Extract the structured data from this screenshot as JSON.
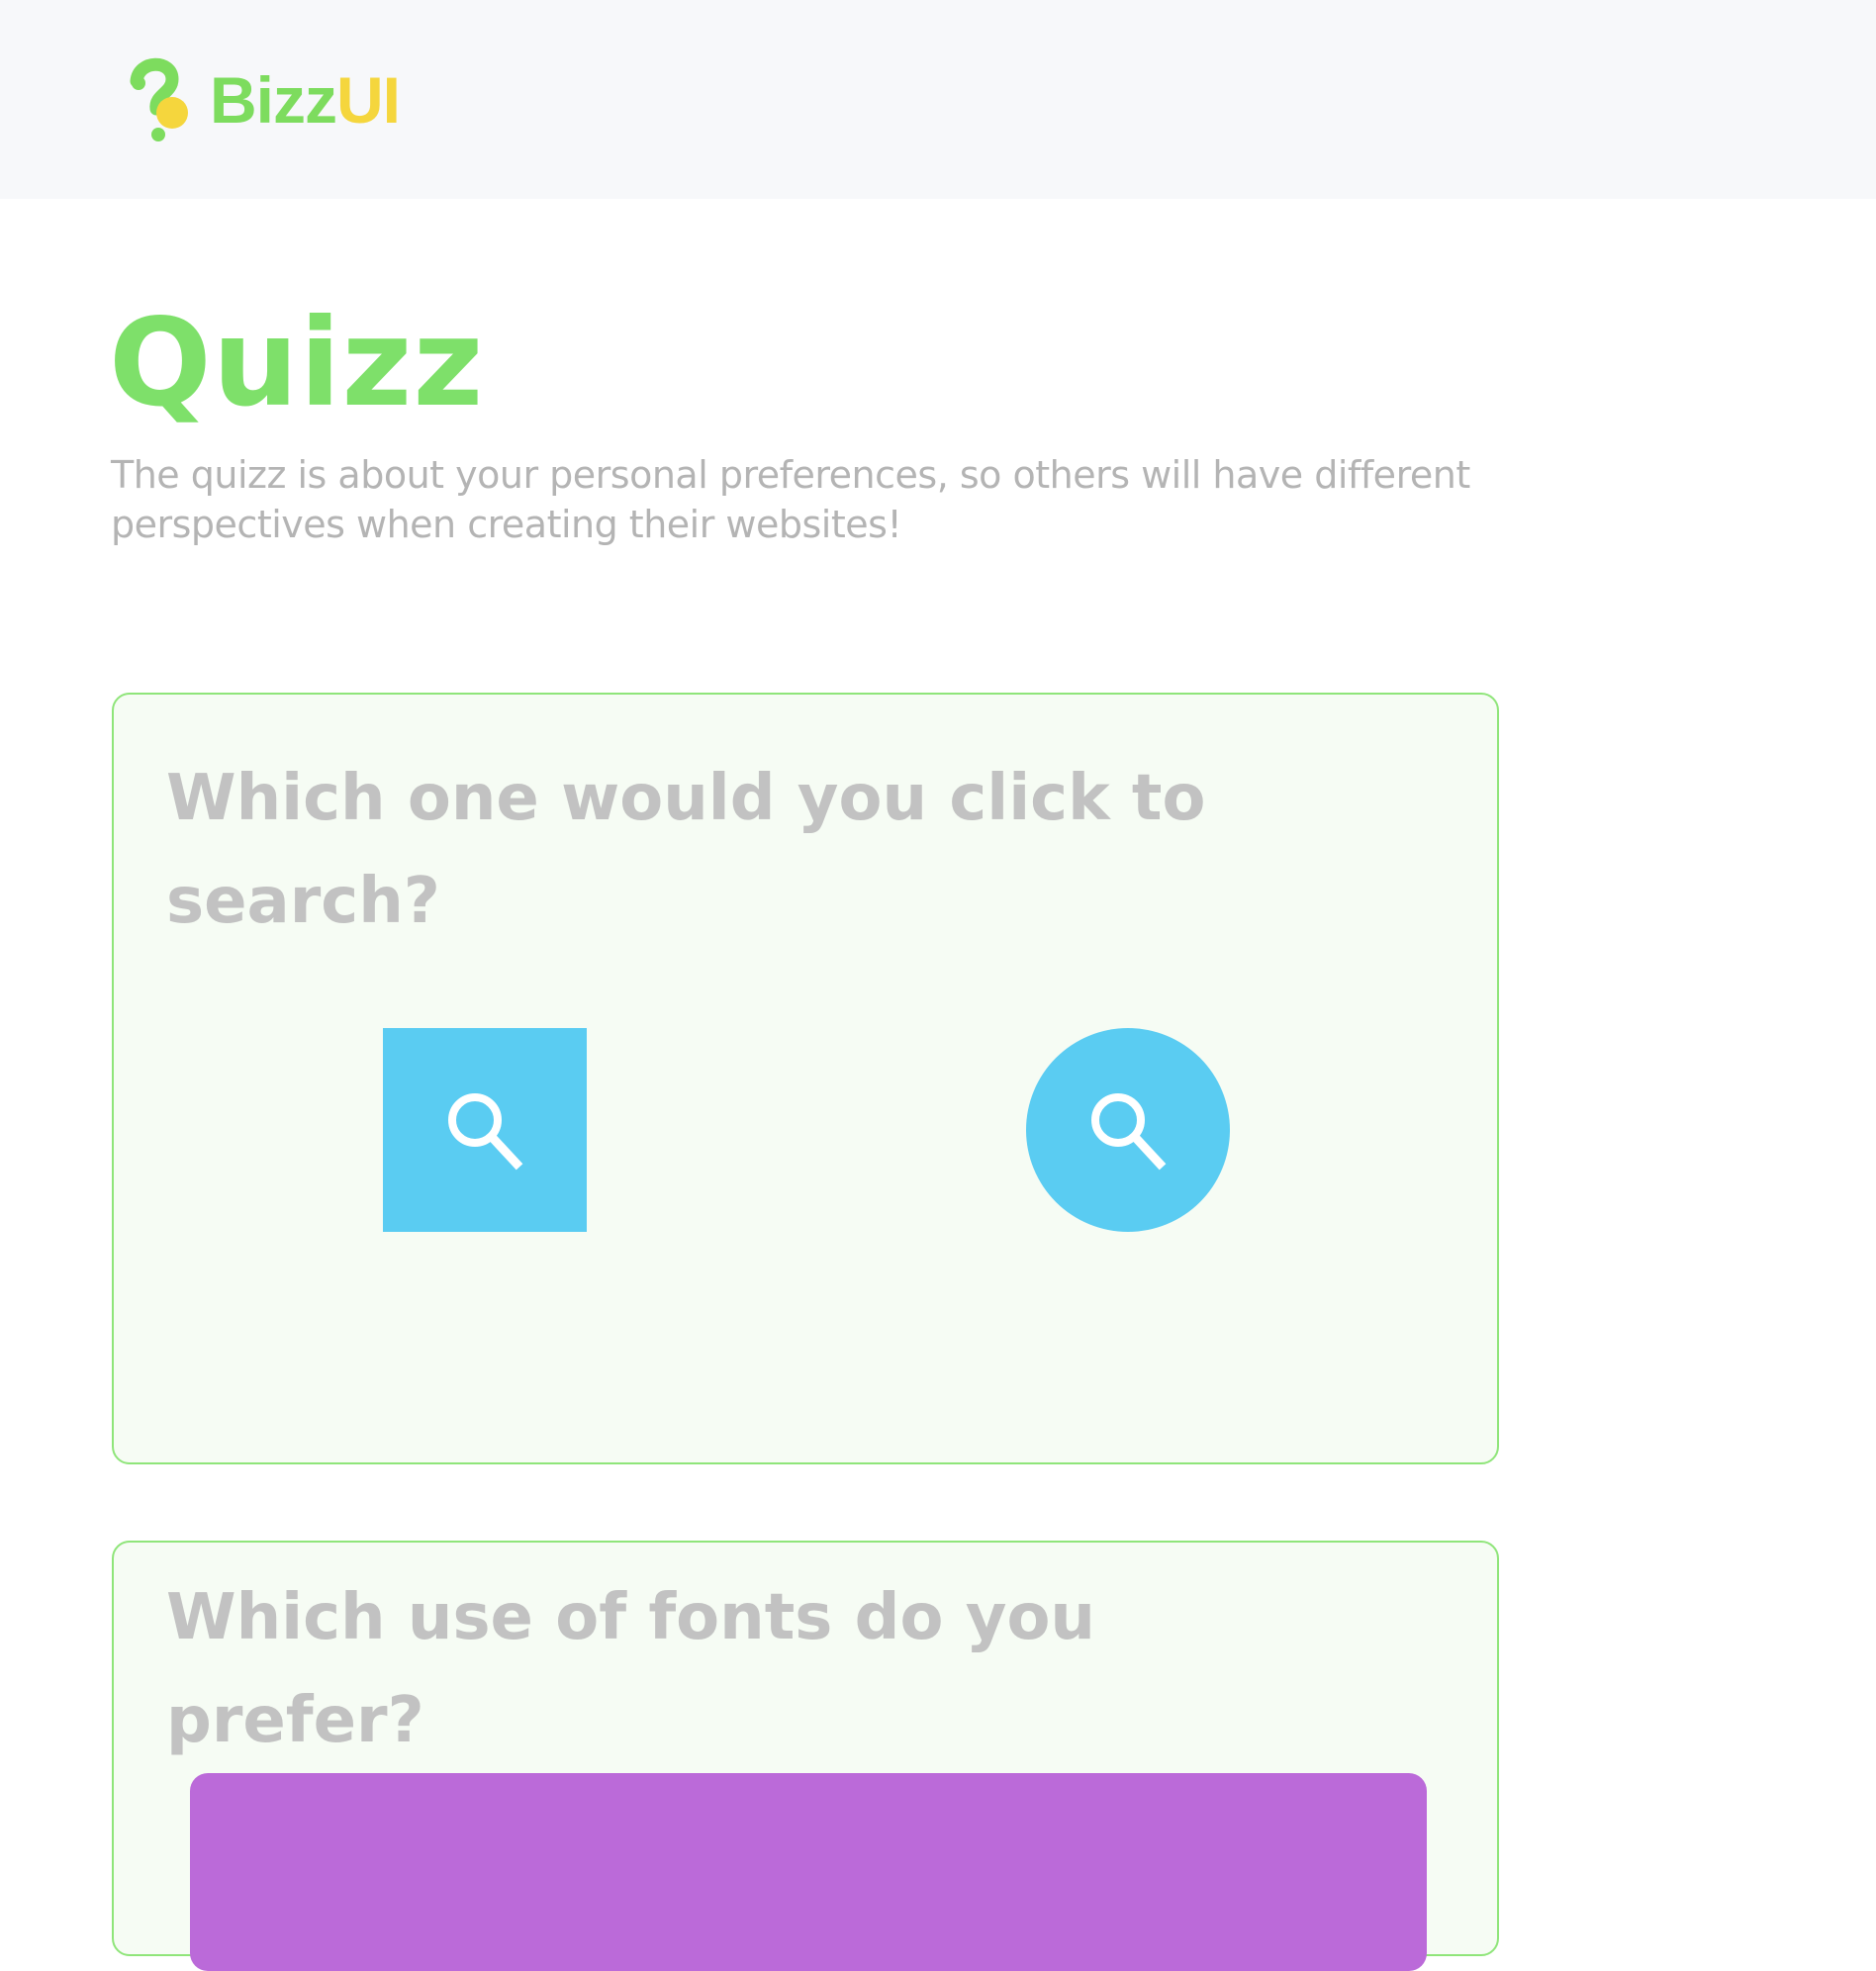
{
  "brand": {
    "name_part1": "Bizz",
    "name_part2": "UI",
    "colors": {
      "green": "#7ddc5e",
      "yellow": "#f5d63d"
    }
  },
  "page": {
    "title": "Quizz",
    "subtitle": "The quizz is about your personal preferences, so others will have different perspectives when creating their websites!"
  },
  "questions": [
    {
      "text": "Which one would you click to search?",
      "options": [
        {
          "icon": "search-icon",
          "shape": "square",
          "color": "#5accf2"
        },
        {
          "icon": "search-icon",
          "shape": "circle",
          "color": "#5accf2"
        }
      ]
    },
    {
      "text": "Which use of fonts do you prefer?",
      "options": [
        {
          "color": "#bb6ad9"
        }
      ]
    }
  ],
  "colors": {
    "card_border": "#8fe57a",
    "card_background": "#f6fcf4",
    "title": "#7ee06a",
    "question_text": "#c2c2c2",
    "subtitle_text": "#b4b4b4"
  }
}
